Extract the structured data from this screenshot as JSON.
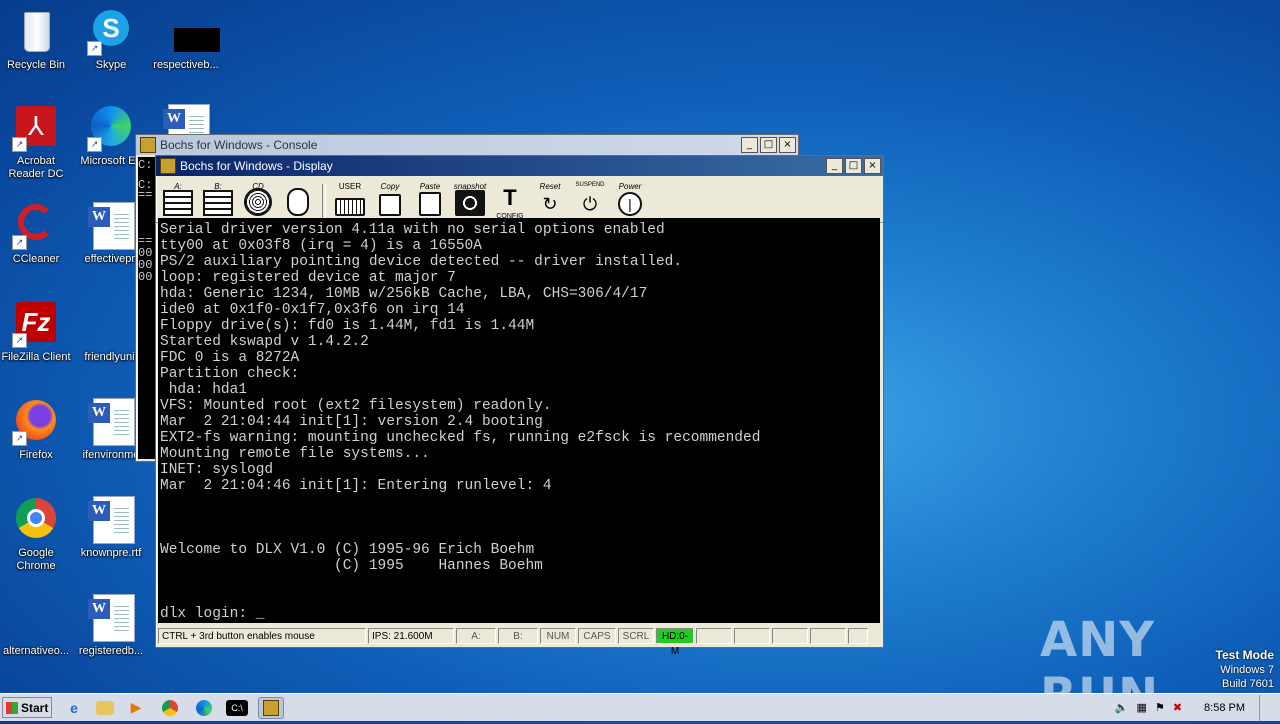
{
  "desktop": {
    "icons": [
      {
        "label": "Recycle Bin",
        "icon": "recycle-bin-icon"
      },
      {
        "label": "Skype",
        "icon": "skype-icon"
      },
      {
        "label": "respectiveb...",
        "icon": "black-file-icon"
      },
      {
        "label": "Acrobat Reader DC",
        "icon": "acrobat-icon"
      },
      {
        "label": "Microsoft Ed",
        "icon": "edge-icon"
      },
      {
        "label": "",
        "icon": "word-doc-icon"
      },
      {
        "label": "CCleaner",
        "icon": "ccleaner-icon"
      },
      {
        "label": "effectivepri",
        "icon": "word-doc-icon"
      },
      {
        "label": "FileZilla Client",
        "icon": "filezilla-icon"
      },
      {
        "label": "friendlyunit",
        "icon": "blank-file-icon"
      },
      {
        "label": "Firefox",
        "icon": "firefox-icon"
      },
      {
        "label": "ifenvironme",
        "icon": "word-doc-icon"
      },
      {
        "label": "Google Chrome",
        "icon": "chrome-icon"
      },
      {
        "label": "knownpre.rtf",
        "icon": "word-doc-icon"
      },
      {
        "label": "alternativeo...",
        "icon": "blank-file-icon"
      },
      {
        "label": "registeredb...",
        "icon": "word-doc-icon"
      }
    ]
  },
  "console_window": {
    "title": "Bochs for Windows - Console",
    "side_text": [
      "C:",
      "C:",
      "==",
      "==",
      "00",
      "00",
      "00"
    ]
  },
  "display_window": {
    "title": "Bochs for Windows - Display",
    "toolbar": [
      {
        "label": "A:",
        "icon": "floppy-a-icon"
      },
      {
        "label": "B:",
        "icon": "floppy-b-icon"
      },
      {
        "label": "CD",
        "icon": "cdrom-icon"
      },
      {
        "label": "",
        "icon": "mouse-icon"
      },
      {
        "label": "USER",
        "icon": "keyboard-icon"
      },
      {
        "label": "Copy",
        "icon": "copy-icon"
      },
      {
        "label": "Paste",
        "icon": "paste-icon"
      },
      {
        "label": "snapshot",
        "icon": "camera-icon"
      },
      {
        "label": "CONFIG",
        "icon": "config-icon"
      },
      {
        "label": "Reset",
        "icon": "reset-icon"
      },
      {
        "label": "SUSPEND",
        "icon": "suspend-icon"
      },
      {
        "label": "Power",
        "icon": "power-icon"
      }
    ],
    "screen_lines": [
      "Serial driver version 4.11a with no serial options enabled",
      "tty00 at 0x03f8 (irq = 4) is a 16550A",
      "PS/2 auxiliary pointing device detected -- driver installed.",
      "loop: registered device at major 7",
      "hda: Generic 1234, 10MB w/256kB Cache, LBA, CHS=306/4/17",
      "ide0 at 0x1f0-0x1f7,0x3f6 on irq 14",
      "Floppy drive(s): fd0 is 1.44M, fd1 is 1.44M",
      "Started kswapd v 1.4.2.2",
      "FDC 0 is a 8272A",
      "Partition check:",
      " hda: hda1",
      "VFS: Mounted root (ext2 filesystem) readonly.",
      "Mar  2 21:04:44 init[1]: version 2.4 booting",
      "EXT2-fs warning: mounting unchecked fs, running e2fsck is recommended",
      "Mounting remote file systems...",
      "INET: syslogd",
      "Mar  2 21:04:46 init[1]: Entering runlevel: 4",
      "",
      "",
      "",
      "Welcome to DLX V1.0 (C) 1995-96 Erich Boehm",
      "                    (C) 1995    Hannes Boehm",
      "",
      "",
      "dlx login: _"
    ],
    "status": {
      "message": "CTRL + 3rd button enables mouse",
      "ips": "IPS: 21.600M",
      "a": "A:",
      "b": "B:",
      "num": "NUM",
      "caps": "CAPS",
      "scrl": "SCRL",
      "hd": "HD:0-M"
    }
  },
  "watermark": "ANY RUN",
  "test_mode": {
    "line1": "Test Mode",
    "line2": "Windows 7",
    "line3": "Build 7601"
  },
  "taskbar": {
    "start_label": "Start",
    "clock": "8:58 PM",
    "pinned": [
      "ie-icon",
      "explorer-icon",
      "media-player-icon",
      "chrome-icon",
      "edge-icon",
      "cmd-icon",
      "bochs-icon"
    ]
  },
  "colors": {
    "hd_active": "#22cc22",
    "title_active": "#0a246a"
  }
}
